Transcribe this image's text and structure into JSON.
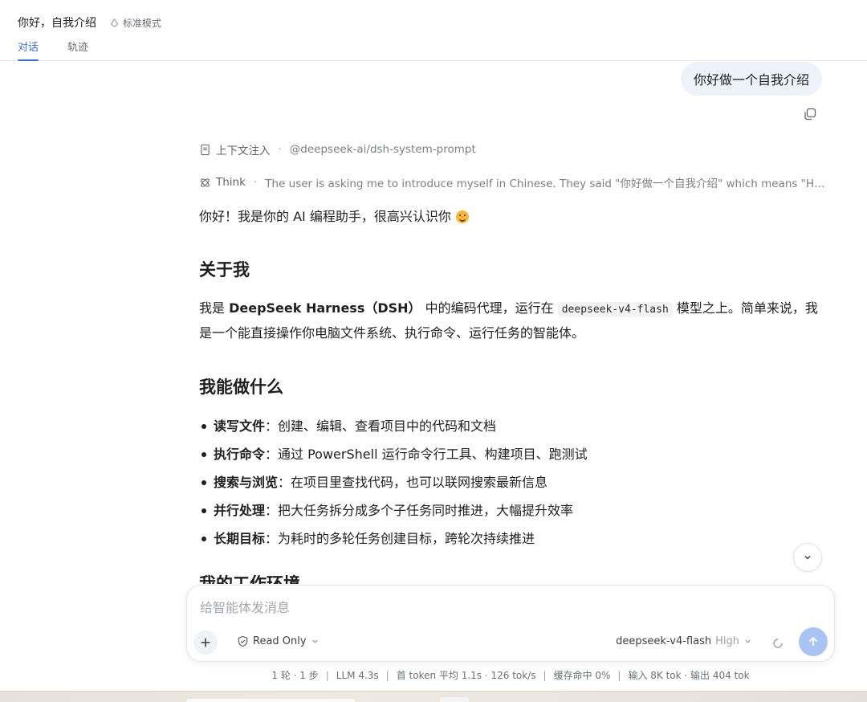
{
  "header": {
    "title": "你好，自我介绍",
    "mode_label": "标准模式",
    "tabs": [
      {
        "label": "对话",
        "active": true
      },
      {
        "label": "轨迹",
        "active": false
      }
    ]
  },
  "conversation": {
    "user_message": "你好做一个自我介绍",
    "context_injection": {
      "label": "上下文注入",
      "source": "@deepseek-ai/dsh-system-prompt"
    },
    "think": {
      "label": "Think",
      "summary": "The user is asking me to introduce myself in Chinese. They said \"你好做一个自我介绍\" which means \"Hello, ..."
    },
    "answer": {
      "greeting": "你好！我是你的 AI 编程助手，很高兴认识你",
      "section1_title": "关于我",
      "section1_pre": "我是 ",
      "section1_bold": "DeepSeek Harness（DSH）",
      "section1_mid": " 中的编码代理，运行在 ",
      "section1_code": "deepseek-v4-flash",
      "section1_post": " 模型之上。简单来说，我是一个能直接操作你电脑文件系统、执行命令、运行任务的智能体。",
      "section2_title": "我能做什么",
      "bullets": [
        {
          "bold": "读写文件",
          "text": "：创建、编辑、查看项目中的代码和文档"
        },
        {
          "bold": "执行命令",
          "text": "：通过 PowerShell 运行命令行工具、构建项目、跑测试"
        },
        {
          "bold": "搜索与浏览",
          "text": "：在项目里查找代码，也可以联网搜索最新信息"
        },
        {
          "bold": "并行处理",
          "text": "：把大任务拆分成多个子任务同时推进，大幅提升效率"
        },
        {
          "bold": "长期目标",
          "text": "：为耗时的多轮任务创建目标，跨轮次持续推进"
        }
      ],
      "section3_title": "我的工作环境"
    }
  },
  "composer": {
    "placeholder": "给智能体发消息",
    "permission": "Read Only",
    "model": "deepseek-v4-flash",
    "level": "High"
  },
  "stats": {
    "turns": "1 轮 · 1 步",
    "llm": "LLM 4.3s",
    "first_token": "首 token 平均 1.1s · 126 tok/s",
    "cache": "缓存命中 0%",
    "tokens": "输入 8K tok · 输出 404 tok"
  },
  "colors": {
    "accent": "#3b6fd8",
    "user_bubble": "#eef2fb",
    "send_button": "#a9c3f2"
  }
}
